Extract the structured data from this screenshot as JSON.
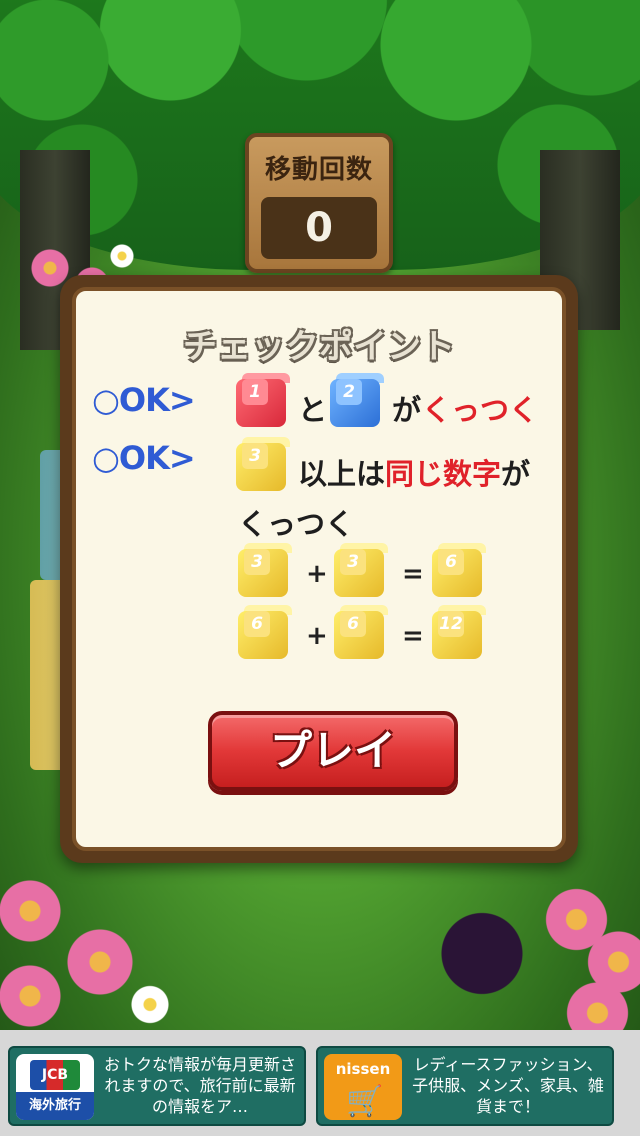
{
  "counter": {
    "label": "移動回数",
    "value": "0"
  },
  "dialog": {
    "title": "チェックポイント",
    "row1": {
      "ok": "○OK>",
      "cube_a": "1",
      "conj": "と",
      "cube_b": "2",
      "ga": "が",
      "verb": "くっつく"
    },
    "row2": {
      "ok": "○OK>",
      "cube": "3",
      "text_a": "以上は",
      "text_red": "同じ数字",
      "text_b": "が",
      "text_c": "くっつく"
    },
    "eq1": {
      "a": "3",
      "b": "3",
      "result": "6",
      "plus": "+",
      "equals": "="
    },
    "eq2": {
      "a": "6",
      "b": "6",
      "result": "12",
      "plus": "+",
      "equals": "="
    },
    "play_label": "プレイ"
  },
  "ads": [
    {
      "icon": "jcb-icon",
      "logo": "JCB",
      "caption": "海外旅行",
      "text": "おトクな情報が毎月更新されますので、旅行前に最新の情報をア…"
    },
    {
      "icon": "nissen-icon",
      "logo": "nissen",
      "text": "レディースファッション、子供服、メンズ、家具、雑貨まで！"
    }
  ],
  "colors": {
    "accent_red": "#e0222a",
    "ok_blue": "#2f5bd4",
    "frame_brown": "#5b3a1c",
    "panel_cream": "#fbf7e6"
  }
}
